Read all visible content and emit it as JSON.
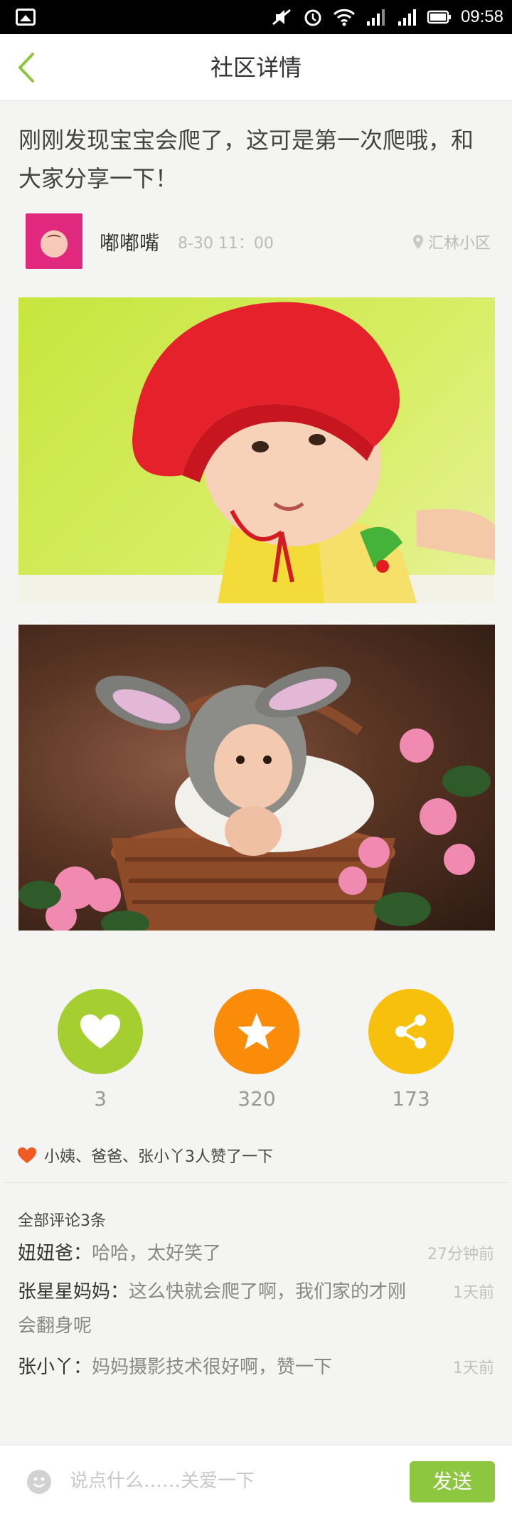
{
  "status_bar": {
    "time": "09:58"
  },
  "header": {
    "title": "社区详情"
  },
  "post": {
    "title": "刚刚发现宝宝会爬了，这可是第一次爬哦，和大家分享一下！",
    "author": "嘟嘟嘴",
    "time": "8-30  11：00",
    "location": "汇林小区"
  },
  "actions": {
    "like_count": "3",
    "favorite_count": "320",
    "share_count": "173"
  },
  "liked_by_text": "小姨、爸爸、张小丫3人赞了一下",
  "comments": {
    "header": "全部评论3条",
    "items": [
      {
        "author": "妞妞爸：",
        "text": "哈哈，太好笑了",
        "time": "27分钟前"
      },
      {
        "author": "张星星妈妈：",
        "text": "这么快就会爬了啊，我们家的才刚会翻身呢",
        "time": "1天前"
      },
      {
        "author": "张小丫：",
        "text": "妈妈摄影技术很好啊，赞一下",
        "time": "1天前"
      }
    ]
  },
  "bottom_bar": {
    "placeholder": "说点什么……关爱一下",
    "send_label": "发送"
  },
  "colors": {
    "accent_green": "#8dc63f",
    "like_green": "#a5ce30",
    "favorite_orange": "#fb8c0a",
    "share_yellow": "#f6c00d",
    "liked_heart": "#f25a24"
  }
}
